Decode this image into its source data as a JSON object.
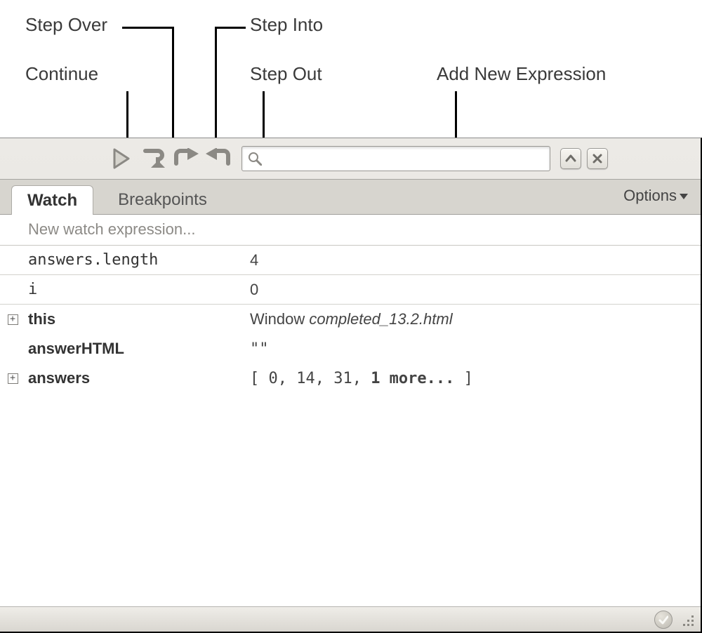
{
  "annotations": {
    "step_over": "Step Over",
    "continue": "Continue",
    "step_into": "Step Into",
    "step_out": "Step Out",
    "add_new_expression": "Add New Expression"
  },
  "colors": {
    "icon_stroke": "#8b8984",
    "icon_fill": "#c7c5bf"
  },
  "toolbar": {
    "continue_label": "Continue",
    "step_over_label": "Step Over",
    "step_into_label": "Step Into",
    "step_out_label": "Step Out",
    "search_placeholder": ""
  },
  "tabs": {
    "watch": "Watch",
    "breakpoints": "Breakpoints",
    "options": "Options"
  },
  "watch": {
    "new_expression_placeholder": "New watch expression...",
    "rows": [
      {
        "expandable": false,
        "name": "answers.length",
        "bold_name": false,
        "value_text": "4",
        "value_plain": true
      },
      {
        "expandable": false,
        "name": "i",
        "bold_name": false,
        "value_text": "0",
        "value_plain": true
      },
      {
        "expandable": true,
        "name": "this",
        "bold_name": true,
        "value_prefix": "Window ",
        "value_italic": "completed_13.2.html"
      },
      {
        "expandable": false,
        "name": "answerHTML",
        "bold_name": true,
        "value_text": "\"\"",
        "value_plain": true
      },
      {
        "expandable": true,
        "name": "answers",
        "bold_name": true,
        "value_array_prefix": "[ 0, 14, 31, ",
        "value_array_more": "1 more...",
        "value_array_suffix": " ]"
      }
    ]
  }
}
